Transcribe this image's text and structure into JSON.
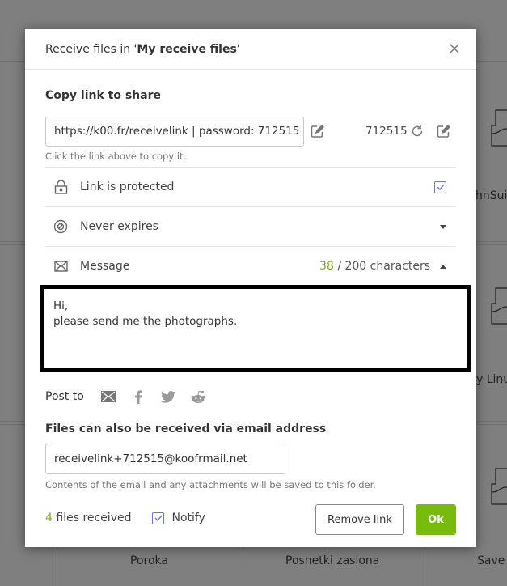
{
  "background": {
    "folders": [
      {
        "label": "Poroka"
      },
      {
        "label": "Posnetki zaslona"
      },
      {
        "label": "Save t"
      },
      {
        "label": "hnSui"
      },
      {
        "label": "y Linu"
      }
    ]
  },
  "dialog": {
    "title_prefix": "Receive files in '",
    "title_folder": "My receive files",
    "title_suffix": "'",
    "close_icon": "close-icon",
    "copy_link": {
      "heading": "Copy link to share",
      "link_value": "https://k00.fr/receivelink | password: 712515",
      "hint": "Click the link above to copy it.",
      "password": "712515"
    },
    "rows": {
      "protected": {
        "label": "Link is protected",
        "checked": true
      },
      "expiry": {
        "label": "Never expires"
      },
      "message": {
        "label": "Message",
        "char_count": "38",
        "char_limit_text": " / 200 characters"
      }
    },
    "message_text": "Hi,\nplease send me the photographs.",
    "post_to": {
      "label": "Post to",
      "targets": [
        "email-icon",
        "facebook-icon",
        "twitter-icon",
        "reddit-icon"
      ]
    },
    "email": {
      "heading": "Files can also be received via email address",
      "address": "receivelink+712515@koofrmail.net",
      "hint": "Contents of the email and any attachments will be saved to this folder."
    },
    "footer": {
      "files_count": "4",
      "files_label": " files received",
      "notify_label": "Notify",
      "notify_checked": true,
      "remove_label": "Remove link",
      "ok_label": "Ok"
    },
    "colors": {
      "accent_green": "#77bb0e",
      "checkbox_blue": "#6b78c7"
    }
  }
}
